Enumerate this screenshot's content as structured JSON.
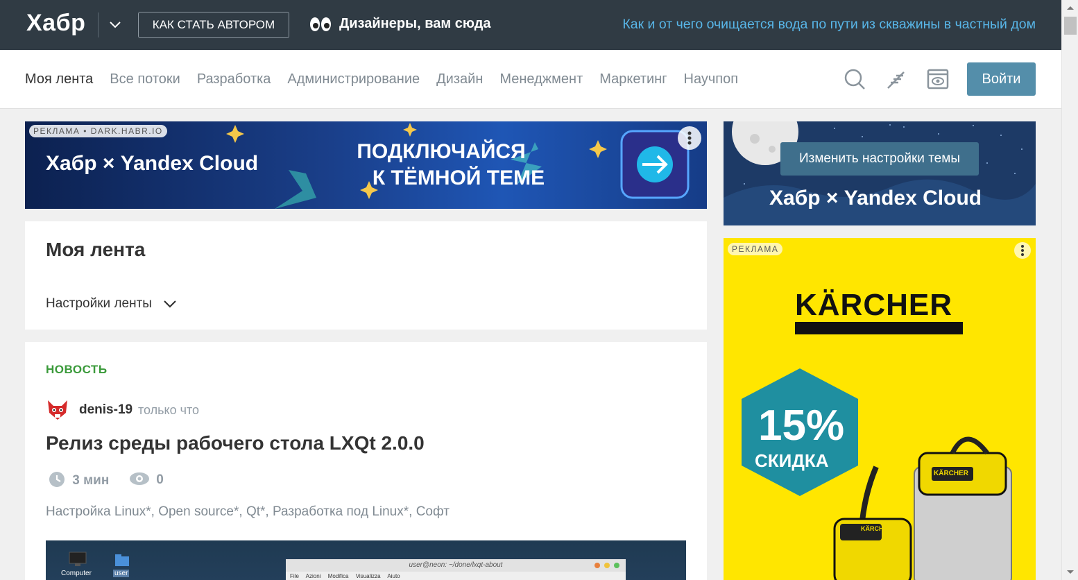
{
  "header": {
    "logo": "Хабр",
    "author_button": "КАК СТАТЬ АВТОРОМ",
    "promo_text": "Дизайнеры, вам сюда",
    "promo_icon": "eyes-emoji",
    "top_link": "Как и от чего очищается вода по пути из скважины в частный дом"
  },
  "nav": {
    "items": [
      {
        "label": "Моя лента",
        "active": true
      },
      {
        "label": "Все потоки"
      },
      {
        "label": "Разработка"
      },
      {
        "label": "Администрирование"
      },
      {
        "label": "Дизайн"
      },
      {
        "label": "Менеджмент"
      },
      {
        "label": "Маркетинг"
      },
      {
        "label": "Научпоп"
      }
    ],
    "icons": [
      "search-icon",
      "write-article-icon",
      "theme-view-icon"
    ],
    "login_button": "Войти"
  },
  "banner": {
    "ad_label": "РЕКЛАМА • DARK.HABR.IO",
    "brand": "Хабр × Yandex Cloud",
    "title_line1": "ПОДКЛЮЧАЙСЯ",
    "title_line2": "К ТЁМНОЙ ТЕМЕ"
  },
  "feed": {
    "title": "Моя лента",
    "settings": "Настройки ленты"
  },
  "article": {
    "tag": "НОВОСТЬ",
    "author": "denis-19",
    "time": "только что",
    "title": "Релиз среды рабочего стола LXQt 2.0.0",
    "read_time": "3 мин",
    "views": "0",
    "hubs": [
      "Настройка Linux*",
      "Open source*",
      "Qt*",
      "Разработка под Linux*",
      "Софт"
    ],
    "screenshot": {
      "desktop_icon1": "Computer",
      "desktop_icon2": "user",
      "window_title": "user@neon: ~/done/lxqt-about",
      "menu": [
        "File",
        "Azioni",
        "Modifica",
        "Visualizza",
        "Aiuto"
      ]
    }
  },
  "sidebar": {
    "theme_button": "Изменить настройки темы",
    "theme_brand": "Хабр × Yandex Cloud",
    "ad_label": "РЕКЛАМА",
    "ad_brand": "KÄRCHER",
    "discount_value": "15%",
    "discount_label": "СКИДКА",
    "product_label": "KÄRCHER"
  },
  "colors": {
    "topbar": "#303b44",
    "link": "#58b6e8",
    "accent_button": "#548eaa",
    "news_tag": "#3a9a3a",
    "karcher_yellow": "#ffe600"
  }
}
